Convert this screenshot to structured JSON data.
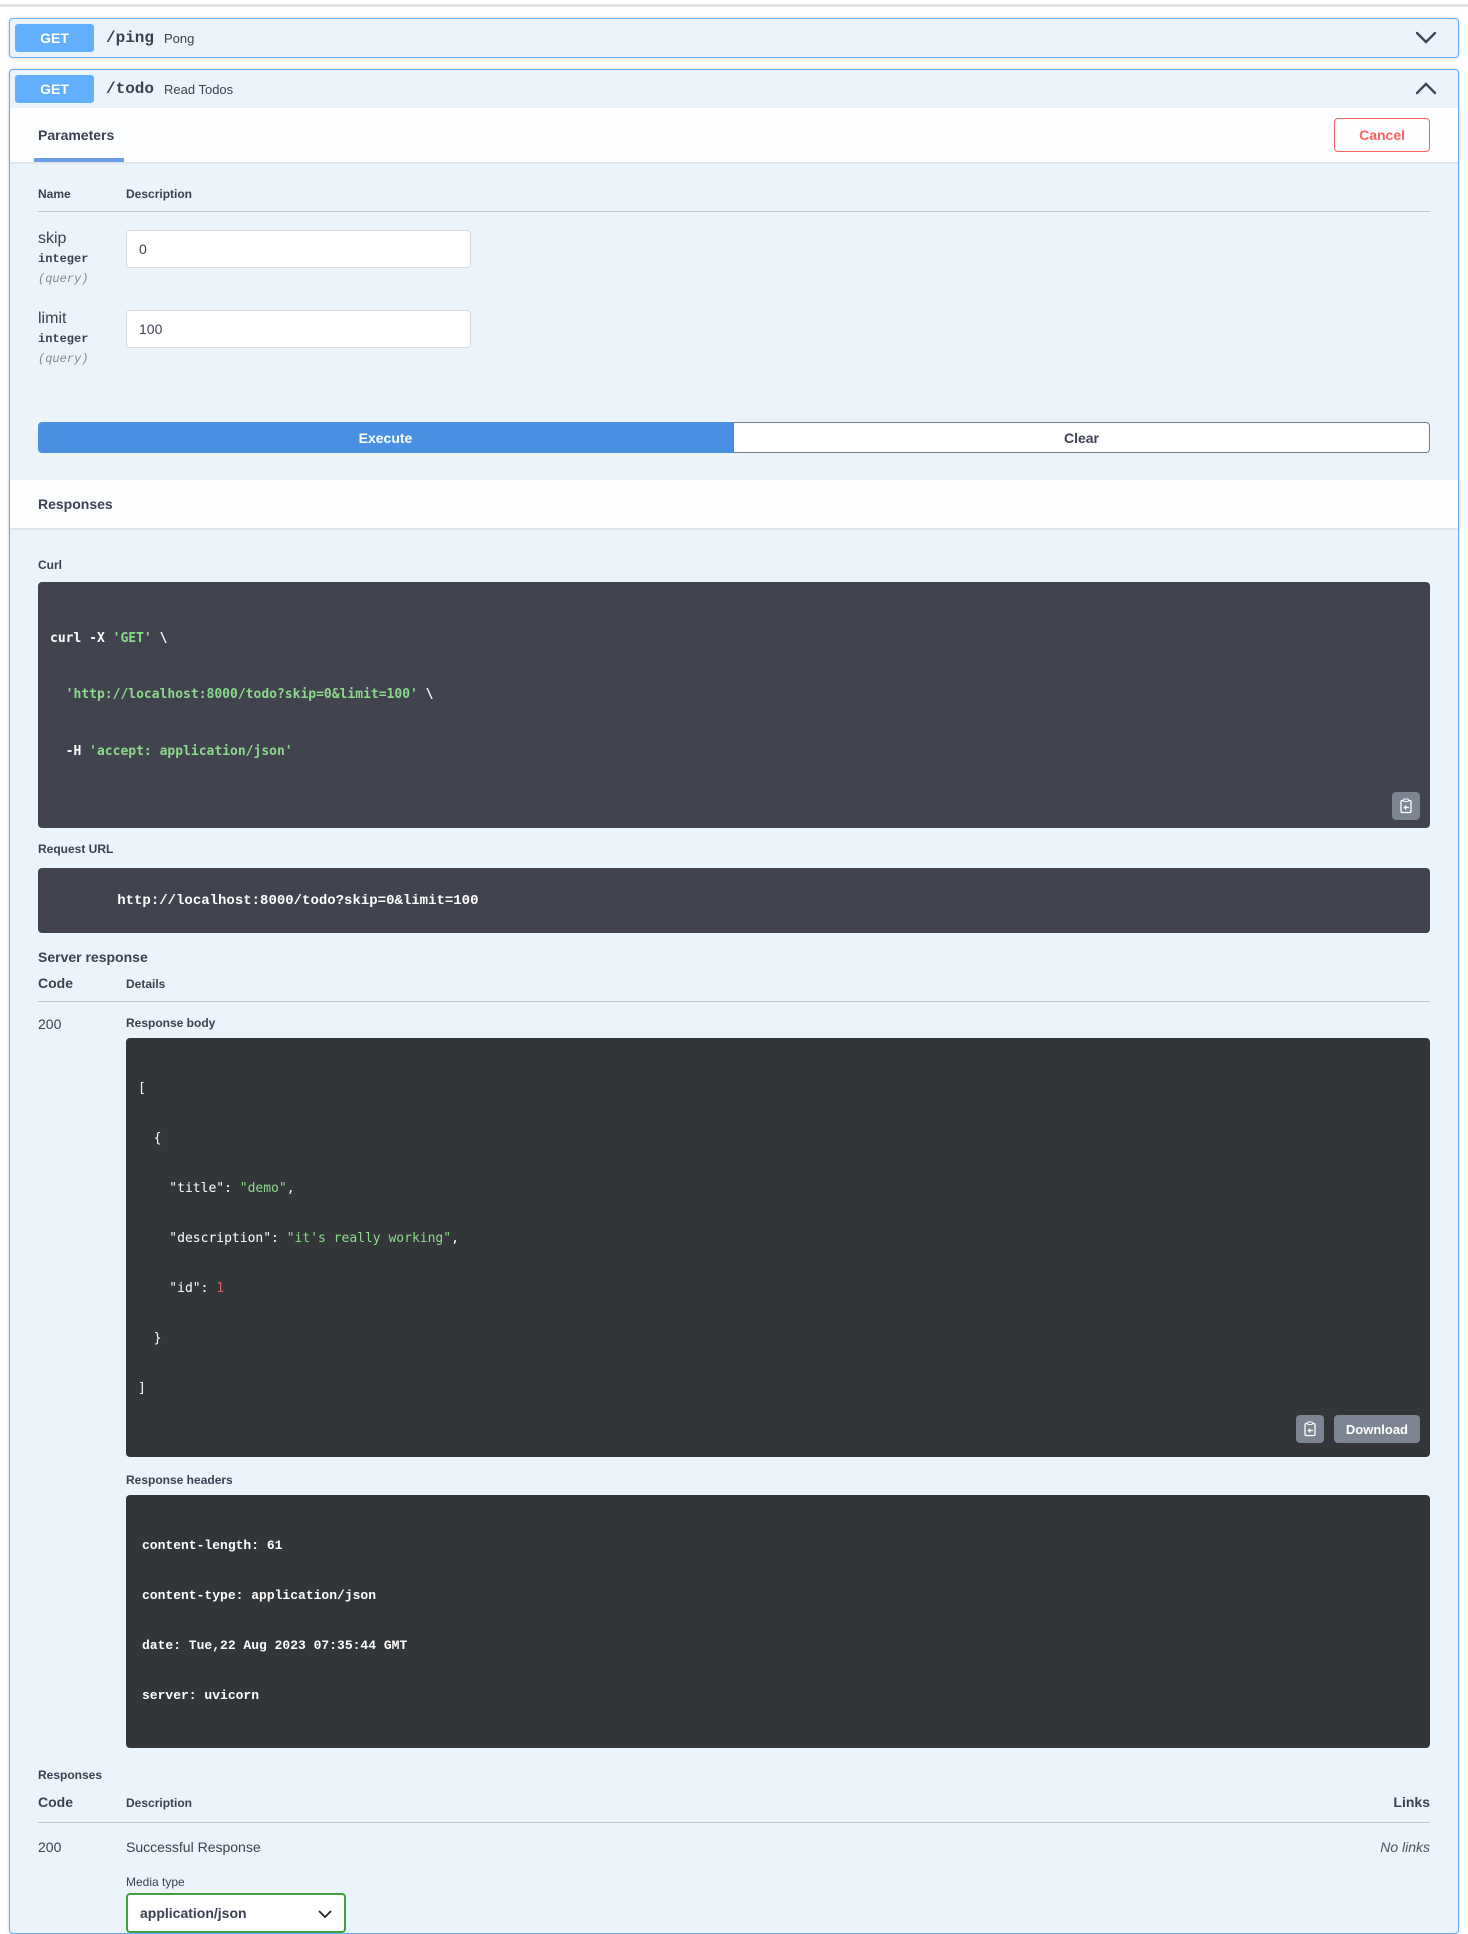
{
  "colors": {
    "accent_blue": "#61affe",
    "execute_blue": "#4990e2",
    "cancel_red": "#ff6060",
    "code_block_bg": "#41444e",
    "string_green": "#8bd98b",
    "number_red": "#d36363",
    "media_select_green": "#3ea13e"
  },
  "endpoints": [
    {
      "method": "GET",
      "path": "/ping",
      "summary": "Pong"
    },
    {
      "method": "GET",
      "path": "/todo",
      "summary": "Read Todos"
    }
  ],
  "todo": {
    "tab_label": "Parameters",
    "cancel_label": "Cancel",
    "table": {
      "name_header": "Name",
      "description_header": "Description"
    },
    "params": [
      {
        "name": "skip",
        "type": "integer",
        "location": "(query)",
        "value": "0"
      },
      {
        "name": "limit",
        "type": "integer",
        "location": "(query)",
        "value": "100"
      }
    ],
    "execute_label": "Execute",
    "clear_label": "Clear",
    "responses_title": "Responses",
    "curl": {
      "label": "Curl",
      "l1_cmd": "curl -X ",
      "l1_str": "'GET'",
      "l1_cont": " \\",
      "l2_str": "  'http://localhost:8000/todo?skip=0&limit=100'",
      "l2_cont": " \\",
      "l3_cmd": "  -H ",
      "l3_str": "'accept: application/json'"
    },
    "request_url": {
      "label": "Request URL",
      "value": "http://localhost:8000/todo?skip=0&limit=100"
    },
    "server_response": {
      "title": "Server response",
      "code_header": "Code",
      "details_header": "Details",
      "code": "200",
      "response_body_label": "Response body",
      "body": {
        "l1": "[",
        "l2": "  {",
        "l3_key": "    \"title\": ",
        "l3_val": "\"demo\"",
        "l3_comma": ",",
        "l4_key": "    \"description\": ",
        "l4_val": "\"it's really working\"",
        "l4_comma": ",",
        "l5_key": "    \"id\": ",
        "l5_val": "1",
        "l6": "  }",
        "l7": "]"
      },
      "download_label": "Download",
      "response_headers_label": "Response headers",
      "headers": [
        "content-length: 61",
        "content-type: application/json",
        "date: Tue,22 Aug 2023 07:35:44 GMT",
        "server: uvicorn"
      ]
    },
    "doc_responses": {
      "title": "Responses",
      "code_header": "Code",
      "description_header": "Description",
      "links_header": "Links",
      "code": "200",
      "description": "Successful Response",
      "links": "No links",
      "media_type_label": "Media type",
      "media_type": "application/json"
    }
  }
}
